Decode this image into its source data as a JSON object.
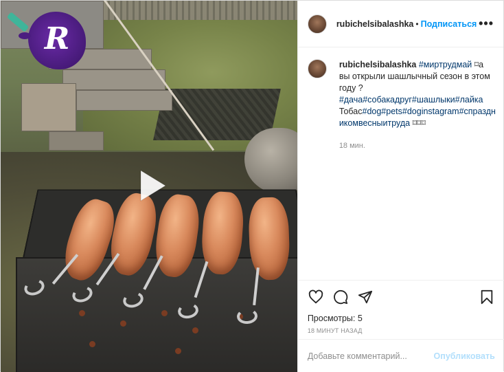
{
  "post": {
    "username": "rubichelsibalashka",
    "follow_label": "Подписаться",
    "more_label": "•••",
    "dot": "•",
    "caption": {
      "username": "rubichelsibalashka",
      "hashtag1": "#миртрудмай",
      "text1": " ⌑а вы открыли шашлычный сезон в этом году ?",
      "hashtags2": "#дача#собакадруг#шашлыки#лайка",
      "text2": "Тобас",
      "hashtags3": "#dog#pets#doginstagram#спраздникомвесныитруда",
      "text3": " ⌑⌑⌑",
      "time": "18 мин."
    },
    "views_label": "Просмотры:",
    "views_count": "5",
    "timestamp": "18 минут назад",
    "comment_placeholder": "Добавьте комментарий...",
    "publish_label": "Опубликовать"
  },
  "media": {
    "logo_letter": "R"
  },
  "icons": {
    "like": "heart-icon",
    "comment": "comment-icon",
    "share": "paper-plane-icon",
    "save": "bookmark-icon",
    "play": "play-icon"
  },
  "colors": {
    "accent": "#0095f6",
    "publish_disabled": "#b2dffc",
    "hashtag": "#00376b",
    "muted": "#8e8e8e"
  }
}
